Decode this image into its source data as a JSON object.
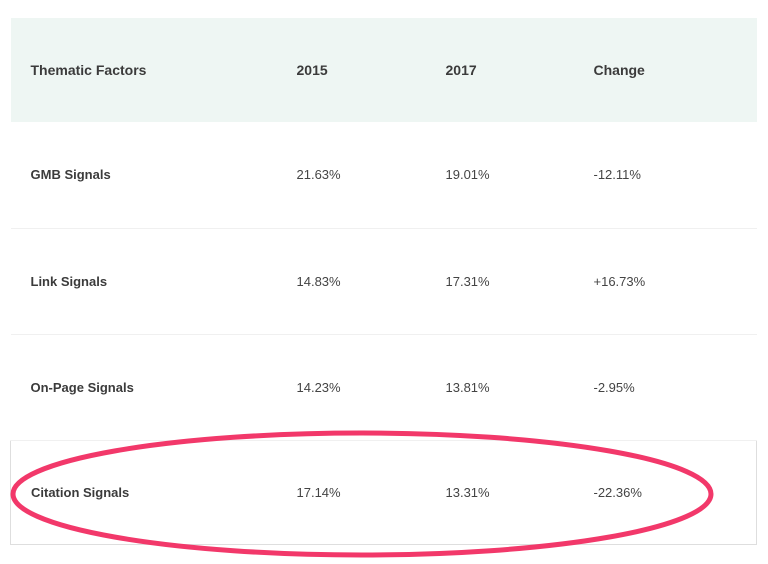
{
  "table": {
    "headers": [
      "Thematic Factors",
      "2015",
      "2017",
      "Change"
    ],
    "rows": [
      {
        "factor": "GMB Signals",
        "y2015": "21.63%",
        "y2017": "19.01%",
        "change": "-12.11%"
      },
      {
        "factor": "Link Signals",
        "y2015": "14.83%",
        "y2017": "17.31%",
        "change": "+16.73%"
      },
      {
        "factor": "On-Page Signals",
        "y2015": "14.23%",
        "y2017": "13.81%",
        "change": "-2.95%"
      },
      {
        "factor": "Citation Signals",
        "y2015": "17.14%",
        "y2017": "13.31%",
        "change": "-22.36%"
      }
    ]
  },
  "colors": {
    "header_bg": "#eef6f3",
    "highlight": "#f2386a"
  }
}
